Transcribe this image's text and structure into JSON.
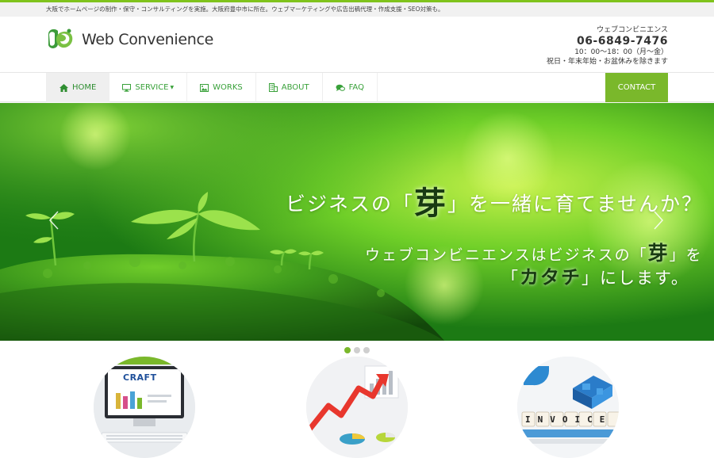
{
  "tagline": "大阪でホームページの制作・保守・コンサルティングを実施。大阪府豊中市に所在。ウェブマーケティングや広告出稿代理・作成支援・SEO対策も。",
  "logo": {
    "text": "Web Convenience"
  },
  "contact": {
    "company": "ウェブコンビニエンス",
    "phone": "06-6849-7476",
    "hours": "10：00〜18：00（月〜金）",
    "closed": "祝日・年末年始・お盆休みを除きます"
  },
  "nav": {
    "items": [
      {
        "label": "HOME",
        "icon": "home-icon"
      },
      {
        "label": "SERVICE",
        "icon": "monitor-icon"
      },
      {
        "label": "WORKS",
        "icon": "image-icon"
      },
      {
        "label": "ABOUT",
        "icon": "building-icon"
      },
      {
        "label": "FAQ",
        "icon": "chat-icon"
      }
    ],
    "contact_label": "CONTACT"
  },
  "hero": {
    "line1_pre": "ビジネスの「",
    "line1_big": "芽",
    "line1_post": "」を一緒に育てませんか？",
    "line2_pre": "ウェブコンビニエンスはビジネスの「",
    "line2_big": "芽",
    "line2_post": "」を",
    "line3_pre": "「",
    "line3_big": "カタチ",
    "line3_post": "」にします。"
  },
  "slider": {
    "dot_count": 3,
    "active_index": 0
  },
  "features": {
    "craft_label": "CRAFT",
    "invoice_label": "INVOICE"
  },
  "colors": {
    "accent": "#7ab82b",
    "nav_text": "#39a13a",
    "top_strip": "#7fc31c"
  }
}
